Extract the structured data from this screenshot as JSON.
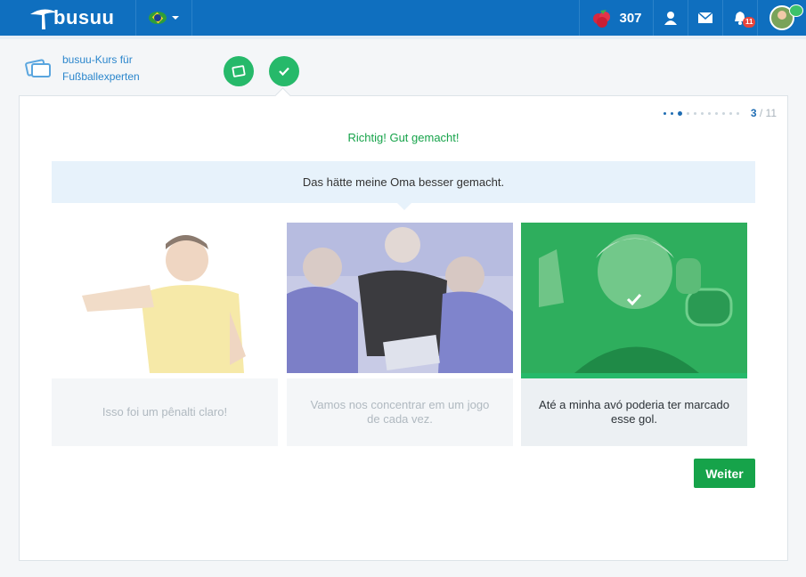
{
  "header": {
    "logo_text": "busuu",
    "berries_count": "307",
    "notification_count": "11",
    "icons": [
      "tree-logo-icon",
      "brazil-flag-icon",
      "raspberry-icon",
      "user-icon",
      "mail-icon",
      "bell-icon",
      "avatar"
    ]
  },
  "course": {
    "title": "busuu-Kurs für Fußballexperten"
  },
  "progress": {
    "current": "3",
    "total": "/ 11",
    "dots_total": 11,
    "dots_done": 3
  },
  "exercise": {
    "feedback": "Richtig! Gut gemacht!",
    "prompt": "Das hätte meine Oma besser gemacht.",
    "options": [
      {
        "caption": "Isso foi um pênalti claro!",
        "image": "referee-whistle-photo",
        "selected": false
      },
      {
        "caption": "Vamos nos concentrar em um jogo de cada vez.",
        "image": "team-huddle-photo",
        "selected": false
      },
      {
        "caption": "Até a minha avó poderia ter marcado esse gol.",
        "image": "grandmother-dumbbell-photo",
        "selected": true
      }
    ],
    "continue_label": "Weiter"
  },
  "colors": {
    "brand_blue": "#0f6fbf",
    "success_green": "#26b96a",
    "button_green": "#16a34a",
    "prompt_bg": "#e7f2fb"
  }
}
